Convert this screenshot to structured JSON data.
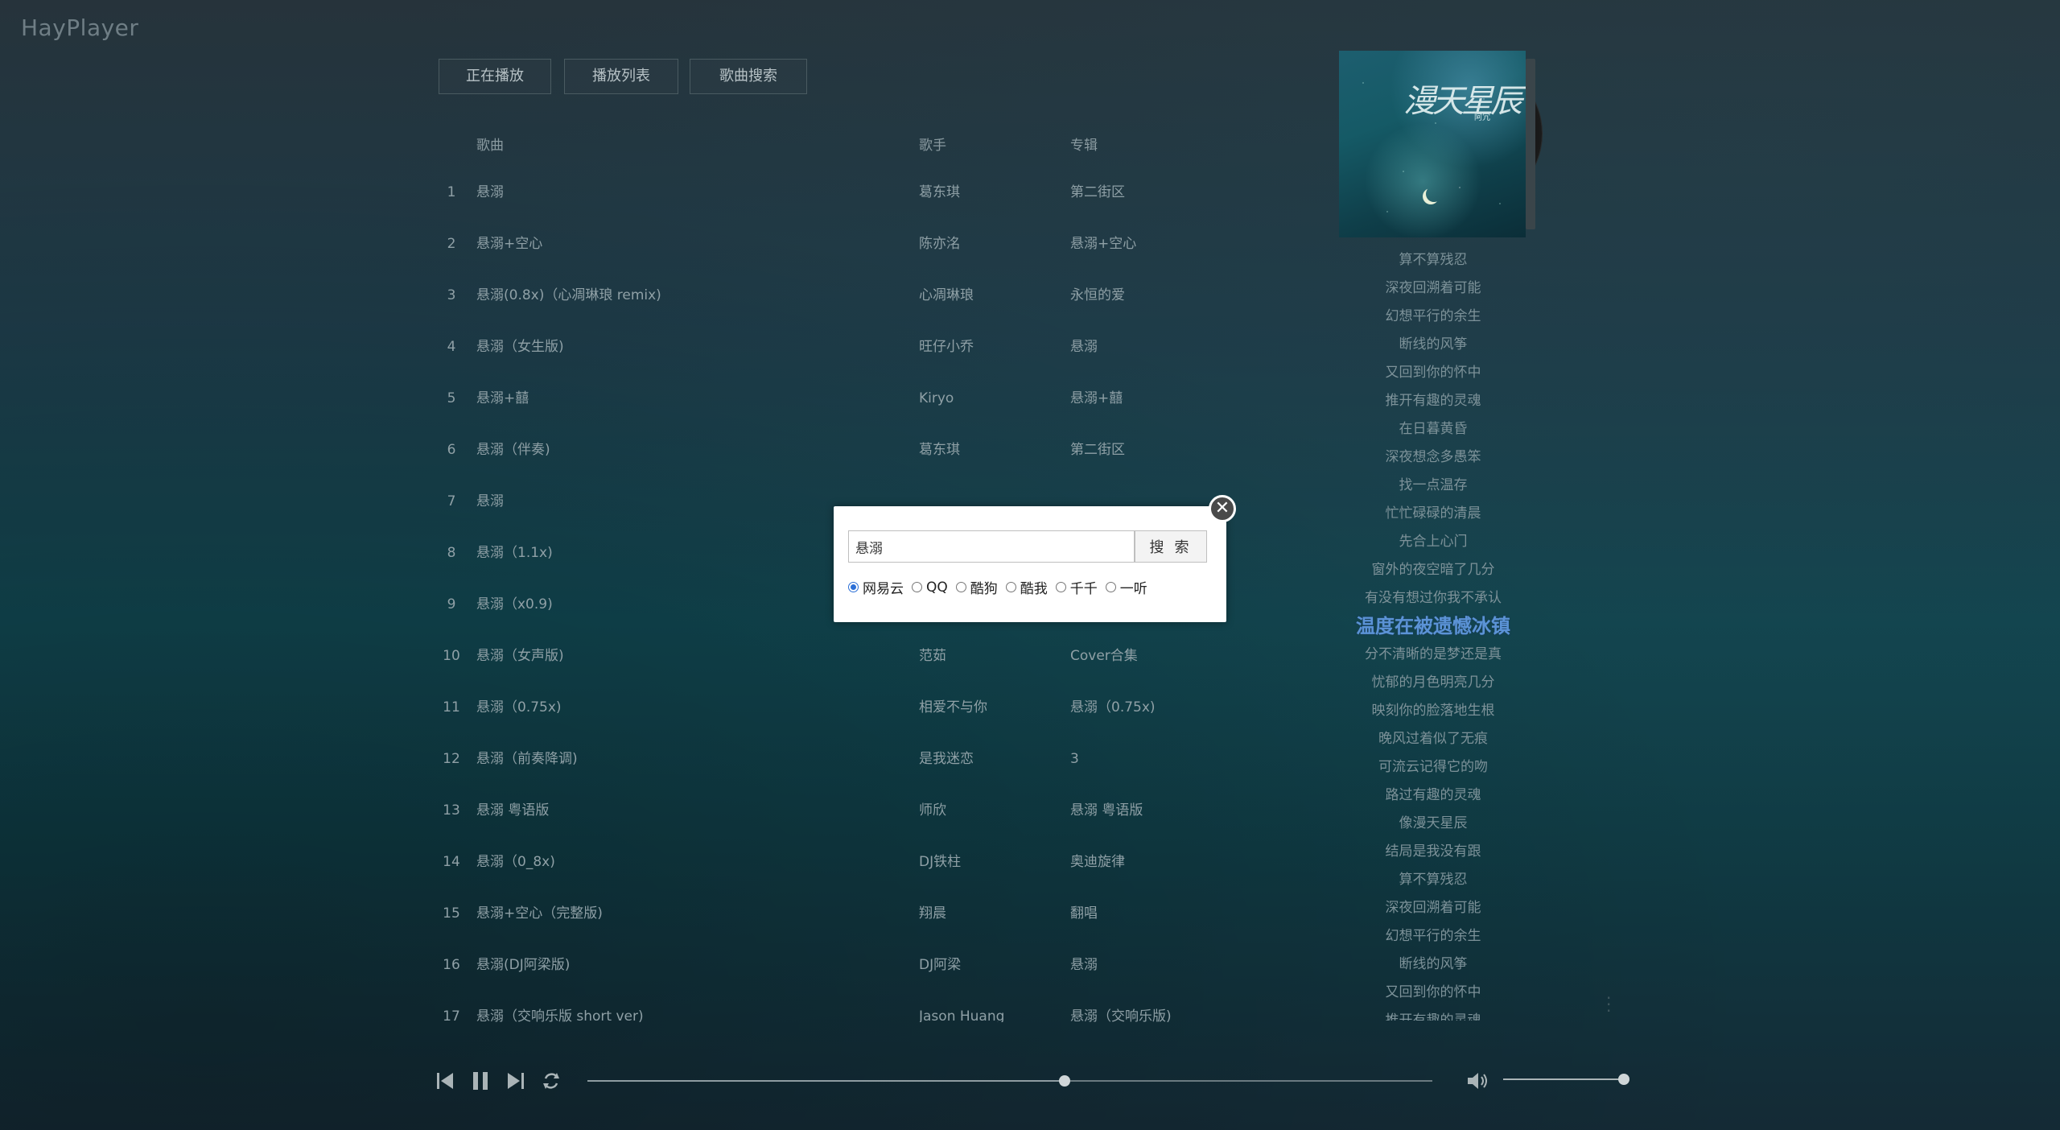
{
  "app": {
    "title": "HayPlayer"
  },
  "tabs": [
    {
      "label": "正在播放"
    },
    {
      "label": "播放列表"
    },
    {
      "label": "歌曲搜索"
    }
  ],
  "table": {
    "headers": {
      "num": "",
      "title": "歌曲",
      "artist": "歌手",
      "album": "专辑"
    },
    "rows": [
      {
        "num": "1",
        "title": "悬溺",
        "artist": "葛东琪",
        "album": "第二街区"
      },
      {
        "num": "2",
        "title": "悬溺+空心",
        "artist": "陈亦洺",
        "album": "悬溺+空心"
      },
      {
        "num": "3",
        "title": "悬溺(0.8x)（心凋琳琅 remix)",
        "artist": "心凋琳琅",
        "album": "永恒的爱"
      },
      {
        "num": "4",
        "title": "悬溺（女生版)",
        "artist": "旺仔小乔",
        "album": "悬溺"
      },
      {
        "num": "5",
        "title": "悬溺+囍",
        "artist": "Kiryo",
        "album": "悬溺+囍"
      },
      {
        "num": "6",
        "title": "悬溺（伴奏)",
        "artist": "葛东琪",
        "album": "第二街区"
      },
      {
        "num": "7",
        "title": "悬溺",
        "artist": "",
        "album": ""
      },
      {
        "num": "8",
        "title": "悬溺（1.1x)",
        "artist": "",
        "album": ""
      },
      {
        "num": "9",
        "title": "悬溺（x0.9)",
        "artist": "",
        "album": ""
      },
      {
        "num": "10",
        "title": "悬溺（女声版)",
        "artist": "范茹",
        "album": "Cover合集"
      },
      {
        "num": "11",
        "title": "悬溺（0.75x)",
        "artist": "相爱不与你",
        "album": "悬溺（0.75x)"
      },
      {
        "num": "12",
        "title": "悬溺（前奏降调)",
        "artist": "是我迷恋",
        "album": "3"
      },
      {
        "num": "13",
        "title": "悬溺 粤语版",
        "artist": "师欣",
        "album": "悬溺 粤语版"
      },
      {
        "num": "14",
        "title": "悬溺（0_8x)",
        "artist": "DJ铁柱",
        "album": "奥迪旋律"
      },
      {
        "num": "15",
        "title": "悬溺+空心（完整版)",
        "artist": "翔晨",
        "album": "翻唱"
      },
      {
        "num": "16",
        "title": "悬溺(DJ阿梁版)",
        "artist": "DJ阿梁",
        "album": "悬溺"
      },
      {
        "num": "17",
        "title": "悬溺（交响乐版 short ver)",
        "artist": "Jason Huang",
        "album": "悬溺（交响乐版)"
      }
    ]
  },
  "now_playing": {
    "cover_title": "漫天星辰",
    "cover_sub": "阿冗"
  },
  "lyrics": {
    "lines": [
      "算不算残忍",
      "深夜回溯着可能",
      "幻想平行的余生",
      "断线的风筝",
      "又回到你的怀中",
      "推开有趣的灵魂",
      "在日暮黄昏",
      "深夜想念多愚笨",
      "找一点温存",
      "忙忙碌碌的清晨",
      "先合上心门",
      "窗外的夜空暗了几分",
      "有没有想过你我不承认",
      "温度在被遗憾冰镇",
      "分不清晰的是梦还是真",
      "忧郁的月色明亮几分",
      "映刻你的脸落地生根",
      "晚风过着似了无痕",
      "可流云记得它的吻",
      "路过有趣的灵魂",
      "像漫天星辰",
      "结局是我没有跟",
      "算不算残忍",
      "深夜回溯着可能",
      "幻想平行的余生",
      "断线的风筝",
      "又回到你的怀中",
      "推开有趣的灵魂"
    ],
    "active_index": 13
  },
  "search_modal": {
    "query": "悬溺",
    "button_label": "搜 索",
    "close_glyph": "✕",
    "sources": [
      {
        "label": "网易云",
        "selected": true
      },
      {
        "label": "QQ",
        "selected": false
      },
      {
        "label": "酷狗",
        "selected": false
      },
      {
        "label": "酷我",
        "selected": false
      },
      {
        "label": "千千",
        "selected": false
      },
      {
        "label": "一听",
        "selected": false
      }
    ]
  },
  "player": {
    "progress": 0.565,
    "volume": 1.0,
    "colors": {
      "accent": "#5b93d6"
    }
  }
}
